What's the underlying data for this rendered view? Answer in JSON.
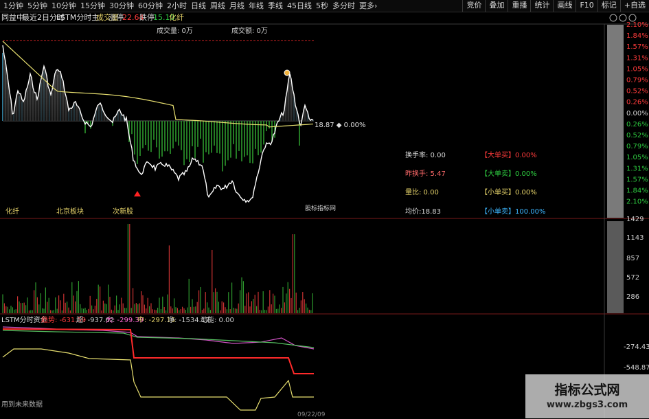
{
  "timeframes": [
    "1分钟",
    "5分钟",
    "10分钟",
    "15分钟",
    "30分钟",
    "60分钟",
    "2小时",
    "日线",
    "周线",
    "月线",
    "年线",
    "季线",
    "45日线",
    "5秒",
    "多分时",
    "更多›"
  ],
  "tools": [
    "竞价",
    "叠加",
    "重播",
    "统计",
    "画线",
    "F10",
    "标记",
    "+自选"
  ],
  "info": {
    "stock_name": "同益中",
    "chart_mode": "最近2日分时",
    "indicator": "LSTM分时主",
    "volume_label": "成交量",
    "limit_up_label": "涨停",
    "limit_up": "22.64",
    "limit_down_label": "跌停",
    "limit_down": "15.10",
    "tag": "化纤"
  },
  "price_header": {
    "vol": "成交量: 0万",
    "amount": "成交额: 0万"
  },
  "price_marker": "18.87 ◆ 0.00%",
  "board_tags": [
    "化纤",
    "北京板块",
    "次新股"
  ],
  "watermark_small": "股标指标网",
  "right_axis_pct": [
    "2.10%",
    "1.84%",
    "1.57%",
    "1.31%",
    "1.05%",
    "0.79%",
    "0.52%",
    "0.26%",
    "0.00%",
    "0.26%",
    "0.52%",
    "0.79%",
    "1.05%",
    "1.31%",
    "1.57%",
    "1.84%",
    "2.10%"
  ],
  "right_axis_pct_colors": [
    "#ff3b3b",
    "#ff3b3b",
    "#ff3b3b",
    "#ff3b3b",
    "#ff3b3b",
    "#ff3b3b",
    "#ff3b3b",
    "#ff3b3b",
    "#d0d0d0",
    "#2ecc40",
    "#2ecc40",
    "#2ecc40",
    "#2ecc40",
    "#2ecc40",
    "#2ecc40",
    "#2ecc40",
    "#2ecc40"
  ],
  "volume_axis": [
    "1429",
    "1143",
    "857",
    "572",
    "286"
  ],
  "fund_axis": [
    "-274.43",
    "-548.87"
  ],
  "stats": {
    "turnover": "换手率: 0.00",
    "prev_turnover": "昨换手: 5.47",
    "vol_ratio": "量比: 0.00",
    "avg_price": "均价:18.83",
    "big_buy": "【大单买】0.00%",
    "big_sell": "【大单卖】0.00%",
    "small_buy": "【小单买】0.00%",
    "small_sell": "【小单卖】100.00%"
  },
  "fund_header": {
    "name": "LSTM分时资金",
    "trend": "趋势: -631.59",
    "super": "超: -937.62",
    "big": "大: -299.39",
    "mid": "中: -297.16",
    "net": "净: -1534.17",
    "momentum": "动能: 0.00"
  },
  "future_text": "用到未来数据",
  "date_text": "09/22/09",
  "site_watermark": {
    "title": "指标公式网",
    "url": "www.zbgs3.com"
  },
  "colors": {
    "up": "#ff3b3b",
    "down": "#2ecc40",
    "price": "#ffffff",
    "avg": "#e8e070",
    "bg": "#000000"
  }
}
